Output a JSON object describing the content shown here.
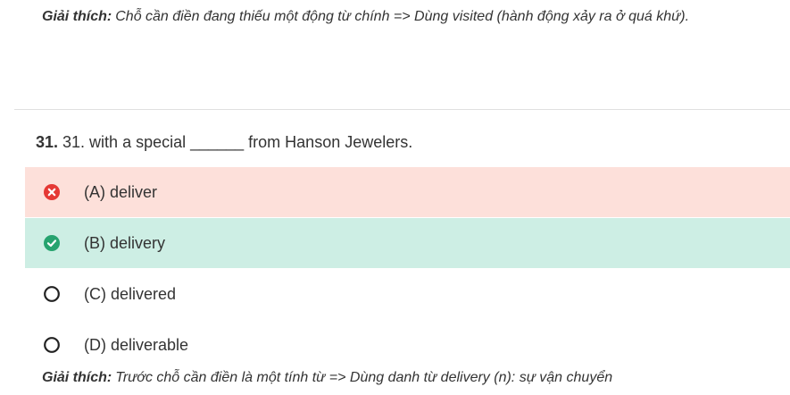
{
  "explanation_top": {
    "label": "Giải thích:",
    "text": "Chỗ cần điền đang thiếu một động từ chính => Dùng visited (hành động xảy ra ở quá khứ)."
  },
  "question": {
    "number": "31.",
    "text": "31. with a special ______ from Hanson Jewelers."
  },
  "options": [
    {
      "label": "(A) deliver",
      "state": "wrong",
      "icon": "x-circle-icon",
      "color": "#e53935"
    },
    {
      "label": "(B) delivery",
      "state": "correct",
      "icon": "check-circle-icon",
      "color": "#26a36f"
    },
    {
      "label": "(C) delivered",
      "state": "unselected",
      "icon": "radio-empty-icon",
      "color": "#222222"
    },
    {
      "label": "(D) deliverable",
      "state": "unselected",
      "icon": "radio-empty-icon",
      "color": "#222222"
    }
  ],
  "explanation_bottom": {
    "label": "Giải thích:",
    "text": "Trước chỗ cần điền là một tính từ => Dùng danh từ delivery (n): sự vận chuyển"
  },
  "colors": {
    "wrong_bg": "#fde0da",
    "correct_bg": "#cdeee4",
    "divider": "#e0e0e0"
  }
}
